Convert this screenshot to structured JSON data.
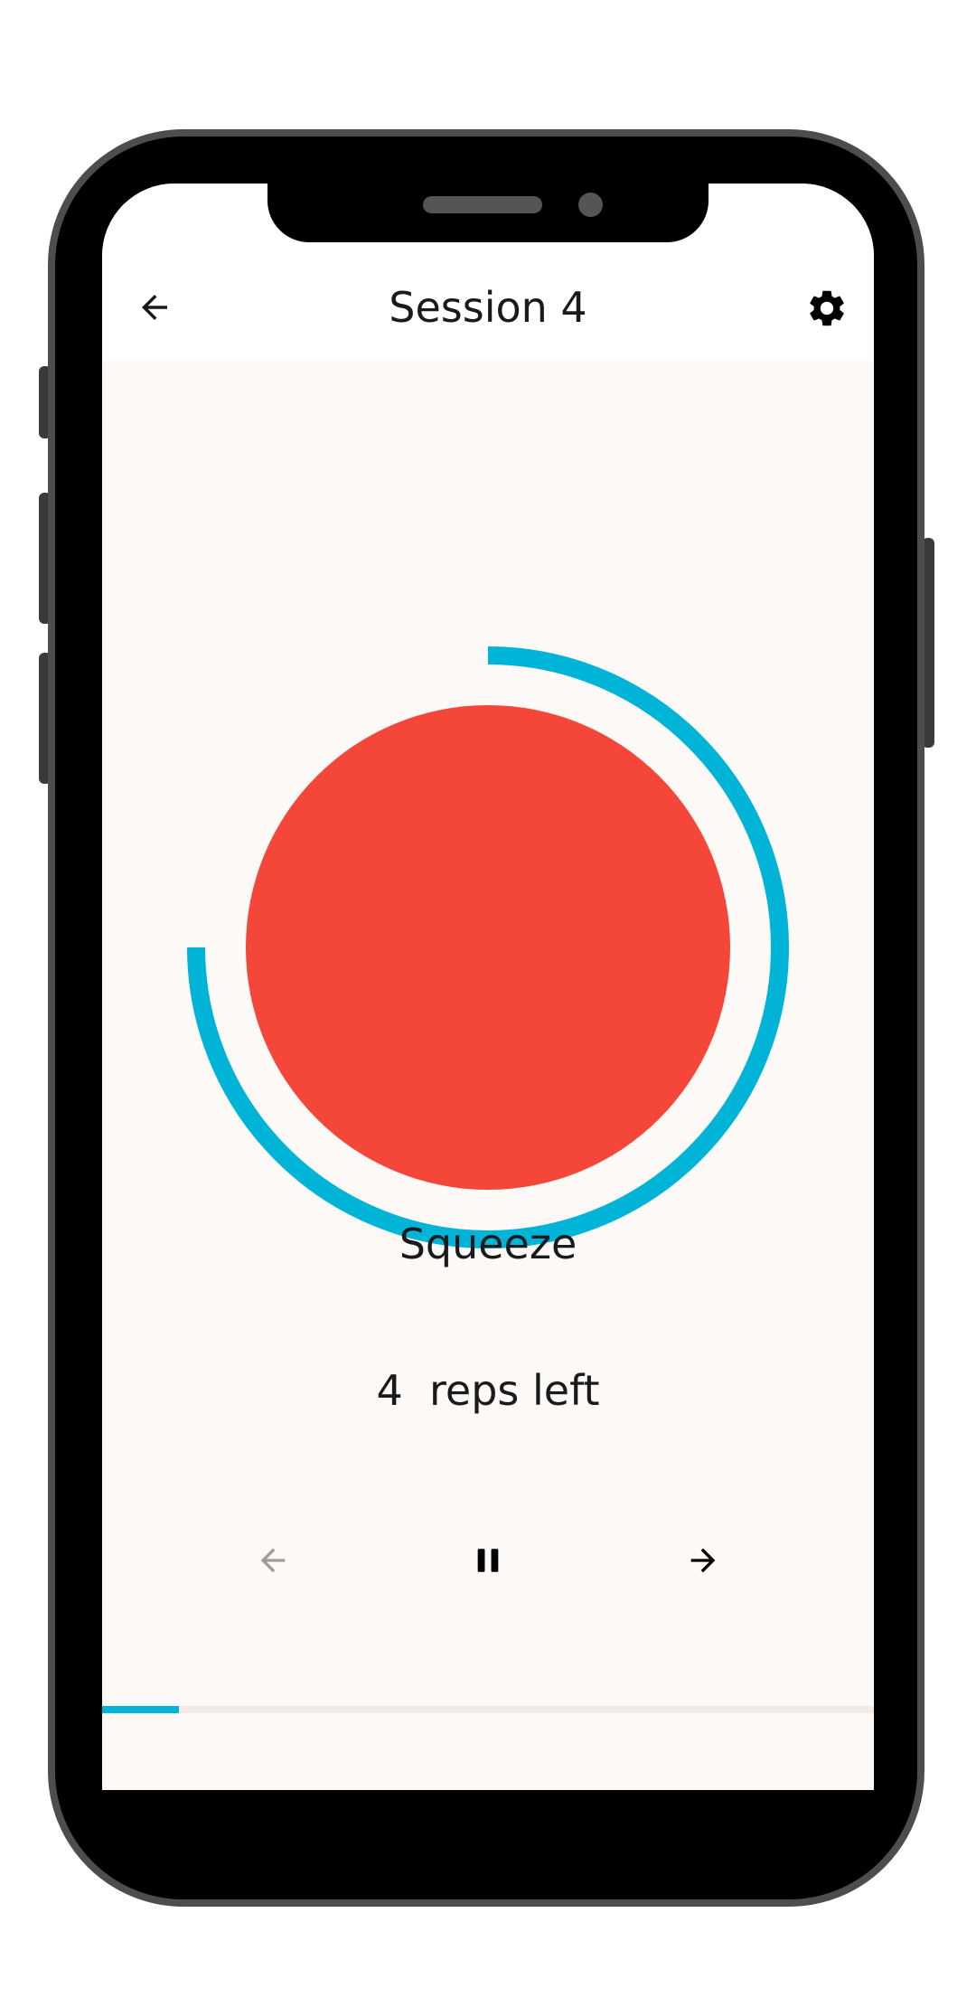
{
  "header": {
    "title": "Session 4",
    "back_icon": "arrow-left-icon",
    "settings_icon": "gear-icon"
  },
  "exercise": {
    "phase_label": "Squeeze",
    "reps_count": "4",
    "reps_text": "4  reps left",
    "timer_progress": 0.75
  },
  "controls": {
    "previous_icon": "arrow-left-icon",
    "pause_icon": "pause-icon",
    "next_icon": "arrow-right-icon",
    "previous_enabled": false
  },
  "session_progress": 0.1,
  "colors": {
    "accent": "#00b4d8",
    "circle": "#f4473a",
    "background": "#fdf9f6",
    "text": "#1a1a1a",
    "disabled": "#9e9e9e"
  }
}
